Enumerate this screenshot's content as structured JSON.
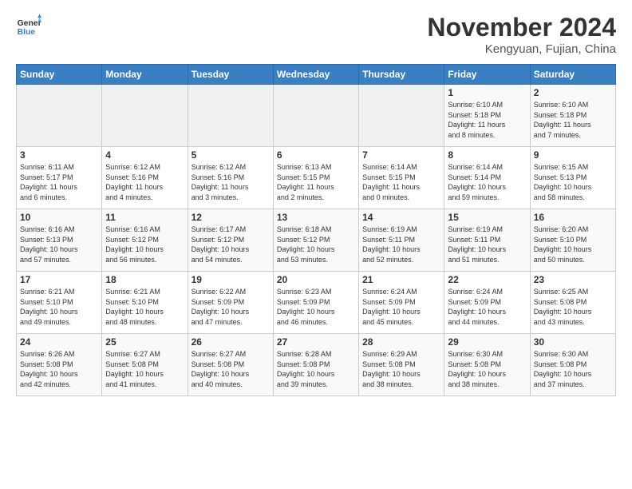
{
  "header": {
    "logo_general": "General",
    "logo_blue": "Blue",
    "month_title": "November 2024",
    "location": "Kengyuan, Fujian, China"
  },
  "weekdays": [
    "Sunday",
    "Monday",
    "Tuesday",
    "Wednesday",
    "Thursday",
    "Friday",
    "Saturday"
  ],
  "weeks": [
    [
      {
        "day": "",
        "info": ""
      },
      {
        "day": "",
        "info": ""
      },
      {
        "day": "",
        "info": ""
      },
      {
        "day": "",
        "info": ""
      },
      {
        "day": "",
        "info": ""
      },
      {
        "day": "1",
        "info": "Sunrise: 6:10 AM\nSunset: 5:18 PM\nDaylight: 11 hours\nand 8 minutes."
      },
      {
        "day": "2",
        "info": "Sunrise: 6:10 AM\nSunset: 5:18 PM\nDaylight: 11 hours\nand 7 minutes."
      }
    ],
    [
      {
        "day": "3",
        "info": "Sunrise: 6:11 AM\nSunset: 5:17 PM\nDaylight: 11 hours\nand 6 minutes."
      },
      {
        "day": "4",
        "info": "Sunrise: 6:12 AM\nSunset: 5:16 PM\nDaylight: 11 hours\nand 4 minutes."
      },
      {
        "day": "5",
        "info": "Sunrise: 6:12 AM\nSunset: 5:16 PM\nDaylight: 11 hours\nand 3 minutes."
      },
      {
        "day": "6",
        "info": "Sunrise: 6:13 AM\nSunset: 5:15 PM\nDaylight: 11 hours\nand 2 minutes."
      },
      {
        "day": "7",
        "info": "Sunrise: 6:14 AM\nSunset: 5:15 PM\nDaylight: 11 hours\nand 0 minutes."
      },
      {
        "day": "8",
        "info": "Sunrise: 6:14 AM\nSunset: 5:14 PM\nDaylight: 10 hours\nand 59 minutes."
      },
      {
        "day": "9",
        "info": "Sunrise: 6:15 AM\nSunset: 5:13 PM\nDaylight: 10 hours\nand 58 minutes."
      }
    ],
    [
      {
        "day": "10",
        "info": "Sunrise: 6:16 AM\nSunset: 5:13 PM\nDaylight: 10 hours\nand 57 minutes."
      },
      {
        "day": "11",
        "info": "Sunrise: 6:16 AM\nSunset: 5:12 PM\nDaylight: 10 hours\nand 56 minutes."
      },
      {
        "day": "12",
        "info": "Sunrise: 6:17 AM\nSunset: 5:12 PM\nDaylight: 10 hours\nand 54 minutes."
      },
      {
        "day": "13",
        "info": "Sunrise: 6:18 AM\nSunset: 5:12 PM\nDaylight: 10 hours\nand 53 minutes."
      },
      {
        "day": "14",
        "info": "Sunrise: 6:19 AM\nSunset: 5:11 PM\nDaylight: 10 hours\nand 52 minutes."
      },
      {
        "day": "15",
        "info": "Sunrise: 6:19 AM\nSunset: 5:11 PM\nDaylight: 10 hours\nand 51 minutes."
      },
      {
        "day": "16",
        "info": "Sunrise: 6:20 AM\nSunset: 5:10 PM\nDaylight: 10 hours\nand 50 minutes."
      }
    ],
    [
      {
        "day": "17",
        "info": "Sunrise: 6:21 AM\nSunset: 5:10 PM\nDaylight: 10 hours\nand 49 minutes."
      },
      {
        "day": "18",
        "info": "Sunrise: 6:21 AM\nSunset: 5:10 PM\nDaylight: 10 hours\nand 48 minutes."
      },
      {
        "day": "19",
        "info": "Sunrise: 6:22 AM\nSunset: 5:09 PM\nDaylight: 10 hours\nand 47 minutes."
      },
      {
        "day": "20",
        "info": "Sunrise: 6:23 AM\nSunset: 5:09 PM\nDaylight: 10 hours\nand 46 minutes."
      },
      {
        "day": "21",
        "info": "Sunrise: 6:24 AM\nSunset: 5:09 PM\nDaylight: 10 hours\nand 45 minutes."
      },
      {
        "day": "22",
        "info": "Sunrise: 6:24 AM\nSunset: 5:09 PM\nDaylight: 10 hours\nand 44 minutes."
      },
      {
        "day": "23",
        "info": "Sunrise: 6:25 AM\nSunset: 5:08 PM\nDaylight: 10 hours\nand 43 minutes."
      }
    ],
    [
      {
        "day": "24",
        "info": "Sunrise: 6:26 AM\nSunset: 5:08 PM\nDaylight: 10 hours\nand 42 minutes."
      },
      {
        "day": "25",
        "info": "Sunrise: 6:27 AM\nSunset: 5:08 PM\nDaylight: 10 hours\nand 41 minutes."
      },
      {
        "day": "26",
        "info": "Sunrise: 6:27 AM\nSunset: 5:08 PM\nDaylight: 10 hours\nand 40 minutes."
      },
      {
        "day": "27",
        "info": "Sunrise: 6:28 AM\nSunset: 5:08 PM\nDaylight: 10 hours\nand 39 minutes."
      },
      {
        "day": "28",
        "info": "Sunrise: 6:29 AM\nSunset: 5:08 PM\nDaylight: 10 hours\nand 38 minutes."
      },
      {
        "day": "29",
        "info": "Sunrise: 6:30 AM\nSunset: 5:08 PM\nDaylight: 10 hours\nand 38 minutes."
      },
      {
        "day": "30",
        "info": "Sunrise: 6:30 AM\nSunset: 5:08 PM\nDaylight: 10 hours\nand 37 minutes."
      }
    ]
  ]
}
